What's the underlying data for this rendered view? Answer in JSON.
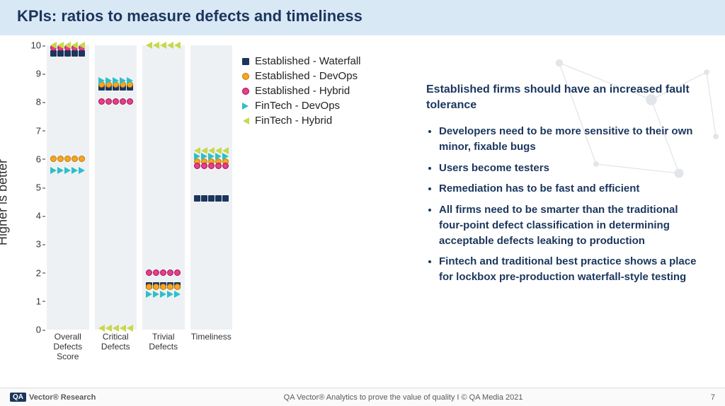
{
  "title": "KPIs: ratios to measure defects and timeliness",
  "y_axis_label": "Higher is better",
  "legend": {
    "s1": "Established - Waterfall",
    "s2": "Established - DevOps",
    "s3": "Established - Hybrid",
    "s4": "FinTech - DevOps",
    "s5": "FinTech - Hybrid"
  },
  "categories": {
    "c0": "Overall\nDefects\nScore",
    "c1": "Critical\nDefects",
    "c2": "Trivial\nDefects",
    "c3": "Timeliness"
  },
  "sidebar": {
    "heading": "Established firms should have an increased fault tolerance",
    "b0": "Developers need to be more sensitive to their own minor, fixable bugs",
    "b1": "Users become testers",
    "b2": "Remediation has to be fast and efficient",
    "b3": "All firms need to be smarter than the traditional four-point defect classification in determining acceptable defects leaking to production",
    "b4": "Fintech and traditional best practice shows a place for lockbox pre-production waterfall-style testing"
  },
  "footer": {
    "brand_qa": "QA",
    "brand_rest": "Vector® Research",
    "center": "QA Vector® Analytics to prove the value of quality I  © QA Media 2021",
    "page": "7"
  },
  "chart_data": {
    "type": "scatter",
    "ylabel": "Higher is better",
    "ylim": [
      0,
      10
    ],
    "categories": [
      "Overall Defects Score",
      "Critical Defects",
      "Trivial Defects",
      "Timeliness"
    ],
    "series": [
      {
        "name": "Established - Waterfall",
        "marker": "square-navy",
        "values": [
          9.7,
          8.5,
          1.55,
          4.6
        ]
      },
      {
        "name": "Established - DevOps",
        "marker": "circle-orange",
        "values": [
          6.0,
          8.6,
          1.5,
          5.9
        ]
      },
      {
        "name": "Established - Hybrid",
        "marker": "circle-pink",
        "values": [
          9.9,
          8.0,
          2.0,
          5.75
        ]
      },
      {
        "name": "FinTech - DevOps",
        "marker": "tri-right-teal",
        "values": [
          5.6,
          8.75,
          1.25,
          6.1
        ]
      },
      {
        "name": "FinTech - Hybrid",
        "marker": "tri-left-olive",
        "values": [
          10.0,
          0.05,
          10.0,
          6.3
        ]
      }
    ]
  }
}
